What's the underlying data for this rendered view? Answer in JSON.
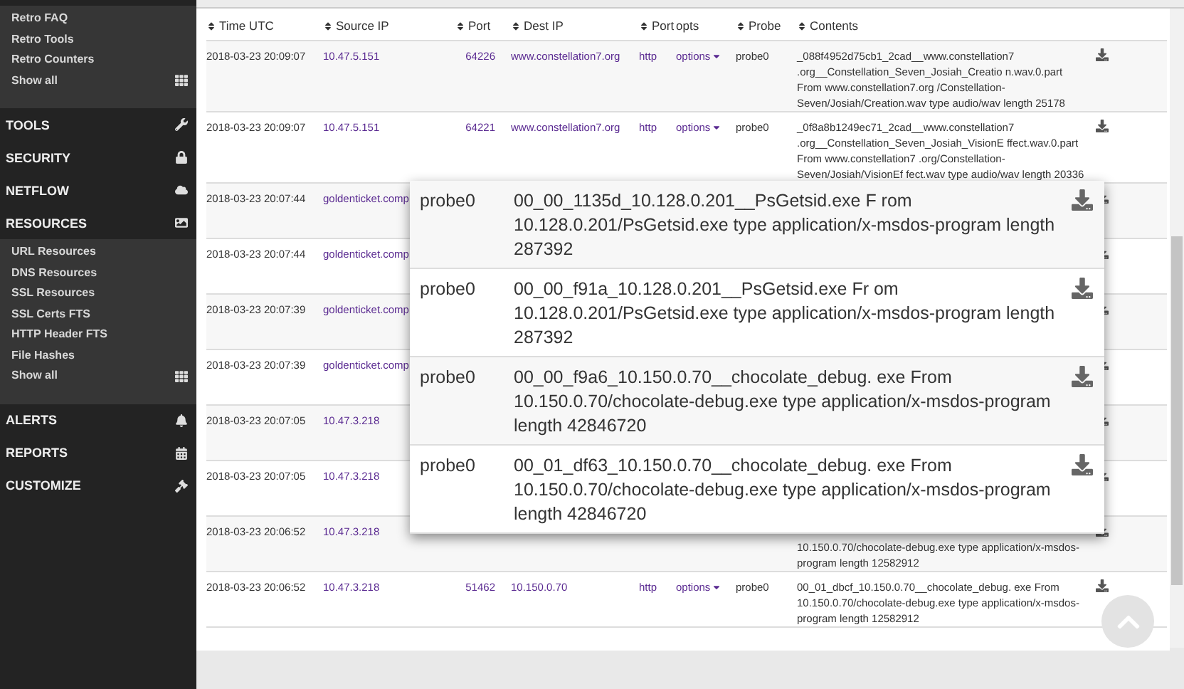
{
  "sidebar": [
    {
      "kind": "submenu",
      "items": [
        "Retro FAQ",
        "Retro Tools",
        "Retro Counters"
      ],
      "show_all": "Show all"
    },
    {
      "kind": "section",
      "label": "TOOLS"
    },
    {
      "kind": "section",
      "label": "SECURITY"
    },
    {
      "kind": "section",
      "label": "NETFLOW"
    },
    {
      "kind": "section",
      "label": "RESOURCES"
    },
    {
      "kind": "submenu",
      "items": [
        "URL Resources",
        "DNS Resources",
        "SSL Resources",
        "SSL Certs FTS",
        "HTTP Header FTS",
        "File Hashes"
      ],
      "show_all": "Show all"
    },
    {
      "kind": "section",
      "label": "ALERTS"
    },
    {
      "kind": "section",
      "label": "REPORTS"
    },
    {
      "kind": "section",
      "label": "CUSTOMIZE"
    }
  ],
  "table": {
    "columns": [
      {
        "label": "Time UTC",
        "sortable": true
      },
      {
        "label": "Source IP",
        "sortable": true
      },
      {
        "label": "Port",
        "sortable": true
      },
      {
        "label": "Dest IP",
        "sortable": true
      },
      {
        "label": "Port",
        "sortable": true
      },
      {
        "label": "opts",
        "sortable": false
      },
      {
        "label": "Probe",
        "sortable": true
      },
      {
        "label": "Contents",
        "sortable": true
      }
    ],
    "rows": [
      {
        "time": "2018-03-23 20:09:07",
        "source_ip": "10.47.5.151",
        "source_port": "64226",
        "dest_ip": "www.constellation7.org",
        "dest_port": "http",
        "opts": "options",
        "probe": "probe0",
        "contents": "_088f4952d75cb1_2cad__www.constellation7 .org__Constellation_Seven_Josiah_Creatio n.wav.0.part From www.constellation7.org /Constellation-Seven/Josiah/Creation.wav type audio/wav length 25178"
      },
      {
        "time": "2018-03-23 20:09:07",
        "source_ip": "10.47.5.151",
        "source_port": "64221",
        "dest_ip": "www.constellation7.org",
        "dest_port": "http",
        "opts": "options",
        "probe": "probe0",
        "contents": "_0f8a8b1249ec71_2cad__www.constellation7 .org__Constellation_Seven_Josiah_VisionE ffect.wav.0.part From www.constellation7 .org/Constellation-Seven/Josiah/VisionEf fect.wav type audio/wav length 20336"
      },
      {
        "time": "2018-03-23 20:07:44",
        "source_ip": "goldenticket.comp"
      },
      {
        "time": "2018-03-23 20:07:44",
        "source_ip": "goldenticket.comp"
      },
      {
        "time": "2018-03-23 20:07:39",
        "source_ip": "goldenticket.comp"
      },
      {
        "time": "2018-03-23 20:07:39",
        "source_ip": "goldenticket.comp"
      },
      {
        "time": "2018-03-23 20:07:05",
        "source_ip": "10.47.3.218"
      },
      {
        "time": "2018-03-23 20:07:05",
        "source_ip": "10.47.3.218"
      },
      {
        "time": "2018-03-23 20:06:52",
        "source_ip": "10.47.3.218",
        "contents_lower": "10.150.0.70/chocolate-debug.exe type application/x-msdos-program length 12582912"
      },
      {
        "time": "2018-03-23 20:06:52",
        "source_ip": "10.47.3.218",
        "source_port": "51462",
        "dest_ip": "10.150.0.70",
        "dest_port": "http",
        "opts": "options",
        "probe": "probe0",
        "contents": "00_01_dbcf_10.150.0.70__chocolate_debug. exe From 10.150.0.70/chocolate-debug.exe type application/x-msdos-program length 12582912"
      }
    ]
  },
  "popup": {
    "rows": [
      {
        "probe": "probe0",
        "contents": "00_00_1135d_10.128.0.201__PsGetsid.exe F rom 10.128.0.201/PsGetsid.exe type application/x-msdos-program length 287392"
      },
      {
        "probe": "probe0",
        "contents": "00_00_f91a_10.128.0.201__PsGetsid.exe Fr om 10.128.0.201/PsGetsid.exe type application/x-msdos-program length 287392"
      },
      {
        "probe": "probe0",
        "contents": "00_00_f9a6_10.150.0.70__chocolate_debug. exe From 10.150.0.70/chocolate-debug.exe type application/x-msdos-program length 42846720"
      },
      {
        "probe": "probe0",
        "contents": "00_01_df63_10.150.0.70__chocolate_debug. exe From 10.150.0.70/chocolate-debug.exe type application/x-msdos-program length 42846720"
      }
    ]
  }
}
